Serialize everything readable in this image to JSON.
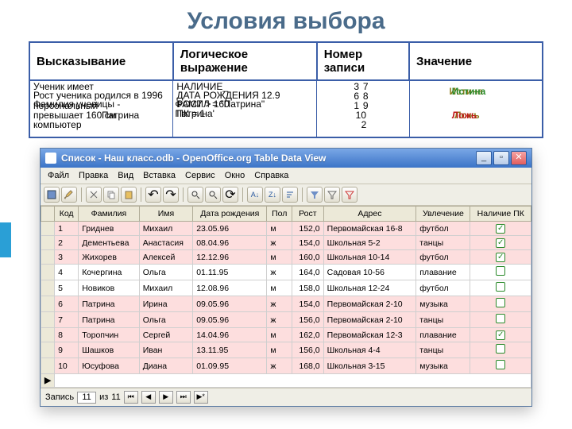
{
  "title": "Условия выбора",
  "columns": {
    "c1": "Высказывание",
    "c2": "Логическое выражение",
    "c3": "Номер записи",
    "c4": "Значение"
  },
  "overlay": {
    "stmt": [
      "Ученик имеет",
      "Рост ученика родился в 1996",
      "Фамилия ученицы -",
      "персональный",
      "превышает 160 см",
      "Патрина",
      "компьютер"
    ],
    "expr": [
      "НАЛИЧИЕ_",
      "ДАТА РОЖДЕНИЯ 12.9",
      "РОСТ > 160",
      "ФАМИЛ = \"Патрина\"",
      "ПК = 1",
      "Патрина'"
    ],
    "nums": [
      "7",
      "3",
      "8",
      "6",
      "1",
      "9",
      "10",
      "2"
    ],
    "vals": [
      {
        "t": "Истина",
        "c": "mix"
      },
      {
        "t": "Истина",
        "c": "true"
      },
      {
        "t": "Ложь",
        "c": "mix"
      },
      {
        "t": "Ложь",
        "c": "false"
      }
    ]
  },
  "window": {
    "caption": "Список - Наш класс.odb - OpenOffice.org Table Data View",
    "menu": [
      "Файл",
      "Правка",
      "Вид",
      "Вставка",
      "Сервис",
      "Окно",
      "Справка"
    ],
    "status": {
      "label_rec": "Запись",
      "value": "11",
      "label_of": "из",
      "total": "11"
    }
  },
  "grid": {
    "headers": [
      "Код",
      "Фамилия",
      "Имя",
      "Дата рождения",
      "Пол",
      "Рост",
      "Адрес",
      "Увлечение",
      "Наличие ПК"
    ],
    "rows": [
      {
        "n": "1",
        "f": "Гриднев",
        "i": "Михаил",
        "d": "23.05.96",
        "p": "м",
        "r": "152,0",
        "a": "Первомайская 16-8",
        "u": "футбол",
        "pc": true,
        "hl": true
      },
      {
        "n": "2",
        "f": "Дементьева",
        "i": "Анастасия",
        "d": "08.04.96",
        "p": "ж",
        "r": "154,0",
        "a": "Школьная 5-2",
        "u": "танцы",
        "pc": true,
        "hl": true
      },
      {
        "n": "3",
        "f": "Жихорев",
        "i": "Алексей",
        "d": "12.12.96",
        "p": "м",
        "r": "160,0",
        "a": "Школьная 10-14",
        "u": "футбол",
        "pc": true,
        "hl": true
      },
      {
        "n": "4",
        "f": "Кочергина",
        "i": "Ольга",
        "d": "01.11.95",
        "p": "ж",
        "r": "164,0",
        "a": "Садовая 10-56",
        "u": "плавание",
        "pc": false,
        "hl": false
      },
      {
        "n": "5",
        "f": "Новиков",
        "i": "Михаил",
        "d": "12.08.96",
        "p": "м",
        "r": "158,0",
        "a": "Школьная 12-24",
        "u": "футбол",
        "pc": false,
        "hl": false
      },
      {
        "n": "6",
        "f": "Патрина",
        "i": "Ирина",
        "d": "09.05.96",
        "p": "ж",
        "r": "154,0",
        "a": "Первомайская 2-10",
        "u": "музыка",
        "pc": false,
        "hl": true
      },
      {
        "n": "7",
        "f": "Патрина",
        "i": "Ольга",
        "d": "09.05.96",
        "p": "ж",
        "r": "156,0",
        "a": "Первомайская 2-10",
        "u": "танцы",
        "pc": false,
        "hl": true
      },
      {
        "n": "8",
        "f": "Торопчин",
        "i": "Сергей",
        "d": "14.04.96",
        "p": "м",
        "r": "162,0",
        "a": "Первомайская 12-3",
        "u": "плавание",
        "pc": true,
        "hl": true
      },
      {
        "n": "9",
        "f": "Шашков",
        "i": "Иван",
        "d": "13.11.95",
        "p": "м",
        "r": "156,0",
        "a": "Школьная 4-4",
        "u": "танцы",
        "pc": false,
        "hl": true
      },
      {
        "n": "10",
        "f": "Юсуфова",
        "i": "Диана",
        "d": "01.09.95",
        "p": "ж",
        "r": "168,0",
        "a": "Школьная 3-15",
        "u": "музыка",
        "pc": false,
        "hl": true
      }
    ]
  }
}
